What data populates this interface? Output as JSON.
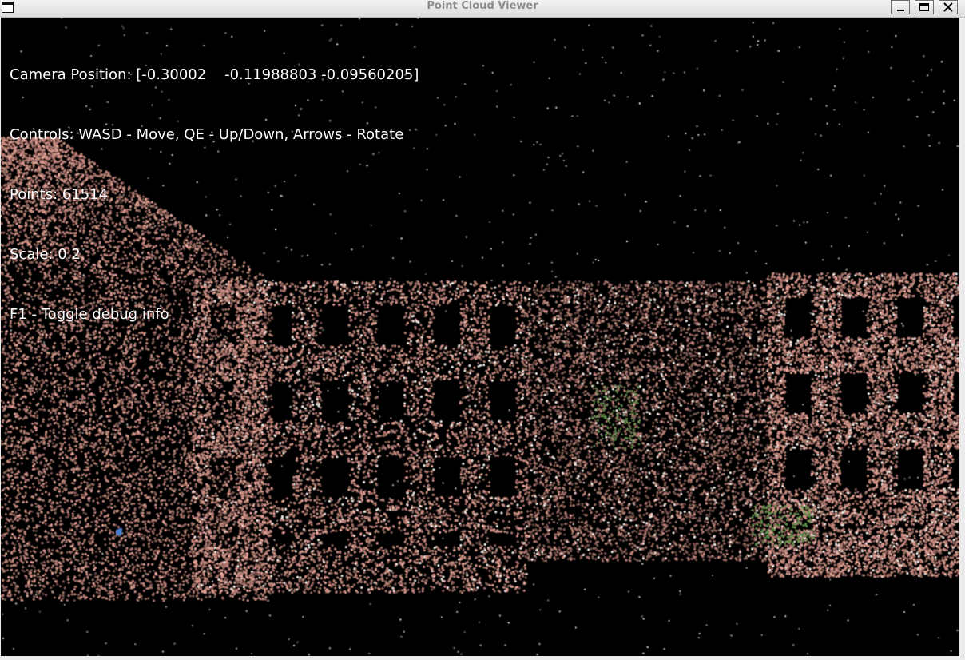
{
  "window": {
    "title": "Point Cloud Viewer",
    "icon": "app-window-icon",
    "controls": [
      "minimize-icon",
      "maximize-icon",
      "close-icon"
    ]
  },
  "hud": {
    "camera_position": "Camera Position: [-0.30002    -0.11988803 -0.09560205]",
    "controls": "Controls: WASD - Move, QE - Up/Down, Arrows - Rotate",
    "points": "Points: 61514",
    "scale": "Scale: 0.2",
    "debug_toggle": "F1 - Toggle debug info"
  },
  "colors": {
    "background": "#000000",
    "point_primary": "#c9a49a",
    "point_highlight": "#e8e2dc",
    "point_green": "#5f8c4a",
    "point_blue": "#4a7fd0"
  }
}
